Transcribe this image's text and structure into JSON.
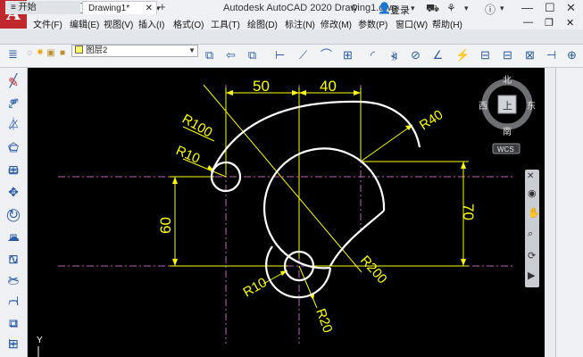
{
  "app": {
    "logo": "A",
    "title": "Autodesk AutoCAD 2020   Drawing1.dwg",
    "login": "登录"
  },
  "menu": [
    "文件(F)",
    "编辑(E)",
    "视图(V)",
    "插入(I)",
    "格式(O)",
    "工具(T)",
    "绘图(D)",
    "标注(N)",
    "修改(M)",
    "参数(P)",
    "窗口(W)",
    "帮助(H)"
  ],
  "tabs": {
    "start": "开始",
    "drawing": "Drawing1*",
    "add": "+"
  },
  "ribbon": {
    "layer_name": "图层2",
    "layer_color": "#ffff66"
  },
  "viewcube": {
    "north": "北",
    "south": "南",
    "west": "西",
    "east": "东",
    "top": "上",
    "wcs": "WCS"
  },
  "drawing": {
    "dim_50": "50",
    "dim_40": "40",
    "dim_60": "60",
    "dim_70": "70",
    "r100": "R100",
    "r10_top": "R10",
    "r40": "R40",
    "r10_bottom": "R10",
    "r200": "R200",
    "r20": "R20",
    "axis_y": "Y"
  },
  "colors": {
    "dim": "#ffff00",
    "geometry": "#ffffff",
    "centerline": "#c060c0",
    "background": "#000000"
  }
}
